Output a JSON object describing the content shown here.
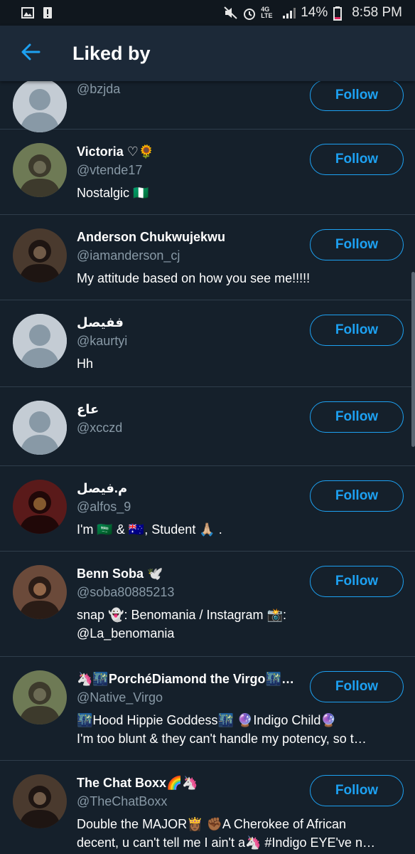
{
  "status_bar": {
    "battery": "14%",
    "time": "8:58 PM",
    "network": "4G LTE"
  },
  "header": {
    "title": "Liked by",
    "back_icon": "arrow-left-icon"
  },
  "colors": {
    "background": "#15202b",
    "app_bar": "#1c2938",
    "accent": "#1da1f2",
    "secondary_text": "#8899a6"
  },
  "follow_label": "Follow",
  "users": [
    {
      "name": "",
      "handle": "@bzjda",
      "bio": [],
      "avatar": "default"
    },
    {
      "name": "Victoria ♡🌻",
      "handle": "@vtende17",
      "bio": [
        "Nostalgic 🇳🇬"
      ],
      "avatar": "photo"
    },
    {
      "name": "Anderson Chukwujekwu",
      "handle": "@iamanderson_cj",
      "bio": [
        "My attitude based on how you see me!!!!!"
      ],
      "avatar": "photo"
    },
    {
      "name": "ففيصل",
      "handle": "@kaurtyi",
      "bio": [
        "Hh"
      ],
      "avatar": "default"
    },
    {
      "name": "عاع",
      "handle": "@xcczd",
      "bio": [],
      "avatar": "default"
    },
    {
      "name": "م.فيصل",
      "handle": "@alfos_9",
      "bio": [
        "I'm 🇸🇦 & 🇦🇺, Student 🙏🏼 ."
      ],
      "avatar": "photo"
    },
    {
      "name": "Benn Soba 🕊️",
      "handle": "@soba80885213",
      "bio": [
        "snap 👻: Benomania / Instagram 📸:",
        "@La_benomania"
      ],
      "avatar": "photo"
    },
    {
      "name": "🦄🌃PorchéDiamond the Virgo🌃…",
      "handle": "@Native_Virgo",
      "bio": [
        "🌃Hood Hippie Goddess🌃 🔮Indigo Child🔮",
        "I'm too blunt & they can't handle my potency, so t…"
      ],
      "avatar": "photo"
    },
    {
      "name": "The Chat Boxx🌈🦄",
      "handle": "@TheChatBoxx",
      "bio": [
        "Double the MAJOR👸🏾 ✊🏾A Cherokee of African",
        "decent, u can't tell me I ain't a🦄 #Indigo EYE've n…"
      ],
      "avatar": "photo"
    }
  ]
}
